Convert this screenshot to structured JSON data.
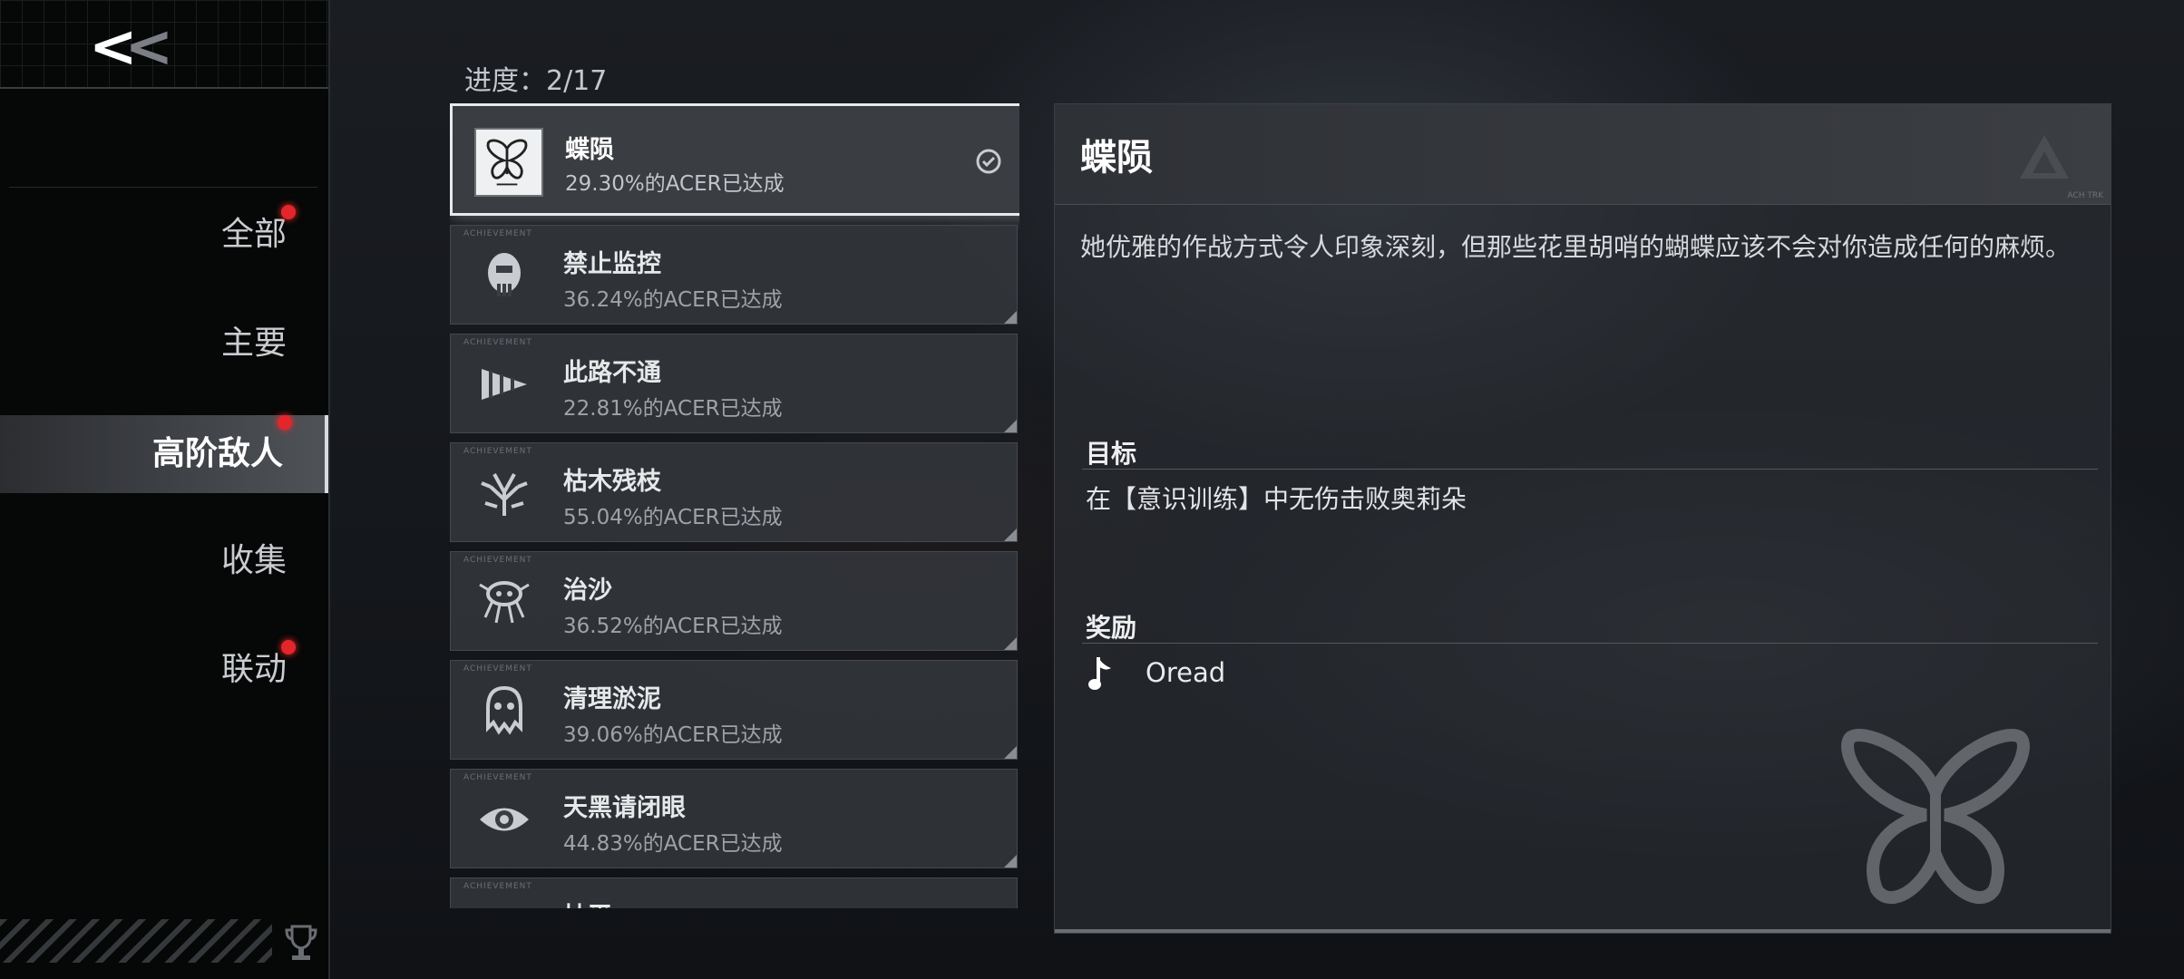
{
  "sidebar": {
    "back_label": "<<",
    "items": [
      {
        "label": "全部",
        "has_dot": true
      },
      {
        "label": "主要",
        "has_dot": false
      },
      {
        "label": "高阶敌人",
        "has_dot": true,
        "active": true
      },
      {
        "label": "收集",
        "has_dot": false
      },
      {
        "label": "联动",
        "has_dot": true
      }
    ]
  },
  "progress_label": "进度：2/17",
  "achievements": [
    {
      "title": "蝶陨",
      "sub": "29.30%的ACER已达成",
      "icon": "butterfly-icon",
      "selected": true,
      "completed": true
    },
    {
      "title": "禁止监控",
      "sub": "36.24%的ACER已达成",
      "icon": "masked-face-icon"
    },
    {
      "title": "此路不通",
      "sub": "22.81%的ACER已达成",
      "icon": "drill-icon"
    },
    {
      "title": "枯木残枝",
      "sub": "55.04%的ACER已达成",
      "icon": "withered-branch-icon"
    },
    {
      "title": "治沙",
      "sub": "36.52%的ACER已达成",
      "icon": "crab-creature-icon"
    },
    {
      "title": "清理淤泥",
      "sub": "39.06%的ACER已达成",
      "icon": "ghost-mask-icon"
    },
    {
      "title": "天黑请闭眼",
      "sub": "44.83%的ACER已达成",
      "icon": "eye-icon"
    },
    {
      "title": "抽平",
      "sub": "",
      "icon": "check-mark-icon"
    }
  ],
  "detail": {
    "title": "蝶陨",
    "description": "她优雅的作战方式令人印象深刻，但那些花里胡哨的蝴蝶应该不会对你造成任何的麻烦。",
    "goal_label": "目标",
    "goal_text": "在【意识训练】中无伤击败奥莉朵",
    "reward_label": "奖励",
    "reward_name": "Oread",
    "reward_icon": "music-note-icon"
  },
  "colors": {
    "accent_red": "#e3262c",
    "selected_border": "#e8eaec"
  }
}
